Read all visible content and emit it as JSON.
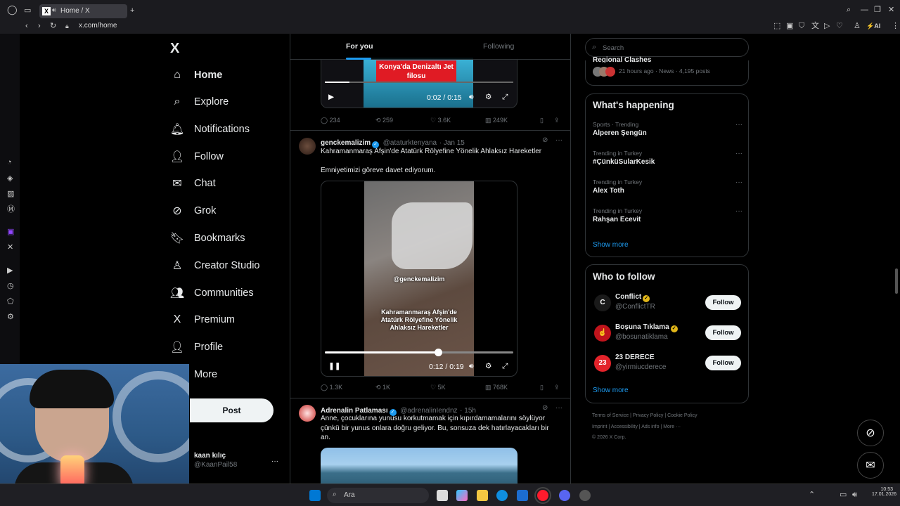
{
  "browser": {
    "tab_title": "Home / X",
    "tab_favicon": "X",
    "url": "x.com/home",
    "new_tab": "+",
    "ai_label": "AI"
  },
  "nav": {
    "logo": "X",
    "items": [
      {
        "label": "Home",
        "icon": "home-icon",
        "glyph": "⌂"
      },
      {
        "label": "Explore",
        "icon": "search-icon",
        "glyph": "⌕"
      },
      {
        "label": "Notifications",
        "icon": "bell-icon",
        "glyph": "🔔︎"
      },
      {
        "label": "Follow",
        "icon": "add-person-icon",
        "glyph": "👤︎"
      },
      {
        "label": "Chat",
        "icon": "mail-icon",
        "glyph": "✉"
      },
      {
        "label": "Grok",
        "icon": "grok-icon",
        "glyph": "⊘"
      },
      {
        "label": "Bookmarks",
        "icon": "bookmark-icon",
        "glyph": "🔖︎"
      },
      {
        "label": "Creator Studio",
        "icon": "creator-studio-icon",
        "glyph": "♙"
      },
      {
        "label": "Communities",
        "icon": "communities-icon",
        "glyph": "👥︎"
      },
      {
        "label": "Premium",
        "icon": "premium-icon",
        "glyph": "X"
      },
      {
        "label": "Profile",
        "icon": "profile-icon",
        "glyph": "👤︎"
      },
      {
        "label": "More",
        "icon": "more-icon",
        "glyph": "⋯"
      }
    ],
    "post_label": "Post",
    "account": {
      "name": "kaan kılıç",
      "handle": "@KaanPail58",
      "menu": "···"
    }
  },
  "feed": {
    "tabs": {
      "for_you": "For you",
      "following": "Following"
    },
    "post1": {
      "overlay_text": "Konya'da Denizaltı Jet filosu",
      "time": "0:02 / 0:15",
      "replies": "234",
      "reposts": "259",
      "likes": "3.6K",
      "views": "249K"
    },
    "post2": {
      "name": "genckemalizim",
      "handle": "@ataturktenyana",
      "date": "· Jan 15",
      "text1": "Kahramanmaraş Afşin'de Atatürk Rölyefine Yönelik Ahlaksız Hareketler",
      "text2": "Emniyetimizi göreve davet ediyorum.",
      "watermark": "@genckemalizim",
      "video_caption": "Kahramanmaraş Afşin'de Atatürk Rölyefine Yönelik Ahlaksız Hareketler",
      "time": "0:12 / 0:19",
      "progress": 0.6,
      "replies": "1.3K",
      "reposts": "1K",
      "likes": "5K",
      "views": "768K",
      "menu": "···"
    },
    "post3": {
      "name": "Adrenalin Patlaması",
      "handle": "@adrenalinIendnz",
      "date": "· 15h",
      "text": "Anne, çocuklarına yunusu korkutmamak için kıpırdamamalarını söylüyor çünkü bir yunus onlara doğru geliyor. Bu, sonsuza dek hatırlayacakları bir an.",
      "menu": "···"
    }
  },
  "right": {
    "search_placeholder": "Search",
    "top_card": {
      "title_partial": "Regional Clashes",
      "meta": "21 hours ago · News · 4,195 posts"
    },
    "happening": {
      "title": "What's happening",
      "trends": [
        {
          "meta": "Sports · Trending",
          "name": "Alperen Şengün"
        },
        {
          "meta": "Trending in Turkey",
          "name": "#ÇünküSularKesik"
        },
        {
          "meta": "Trending in Turkey",
          "name": "Alex Toth"
        },
        {
          "meta": "Trending in Turkey",
          "name": "Rahşan Ecevit"
        }
      ],
      "dots": "···",
      "show_more": "Show more"
    },
    "who_to_follow": {
      "title": "Who to follow",
      "accounts": [
        {
          "name": "Conflict",
          "handle": "@ConflictTR",
          "badge": "gold"
        },
        {
          "name": "Boşuna Tıklama",
          "handle": "@bosunatiklama",
          "badge": "gold"
        },
        {
          "name": "23 DERECE",
          "handle": "@yirmiucderece",
          "badge": ""
        }
      ],
      "follow_label": "Follow",
      "show_more": "Show more"
    },
    "footer": {
      "line1": [
        "Terms of Service",
        "Privacy Policy",
        "Cookie Policy"
      ],
      "line2": [
        "Imprint",
        "Accessibility",
        "Ads info",
        "More ···"
      ],
      "copyright": "© 2026 X Corp."
    }
  },
  "taskbar": {
    "search_placeholder": "Ara",
    "time": "10:53",
    "date": "17.01.2026"
  },
  "colors": {
    "accent": "#1d9bf0",
    "background": "#000000",
    "border": "#2f3336",
    "muted": "#71767b"
  }
}
